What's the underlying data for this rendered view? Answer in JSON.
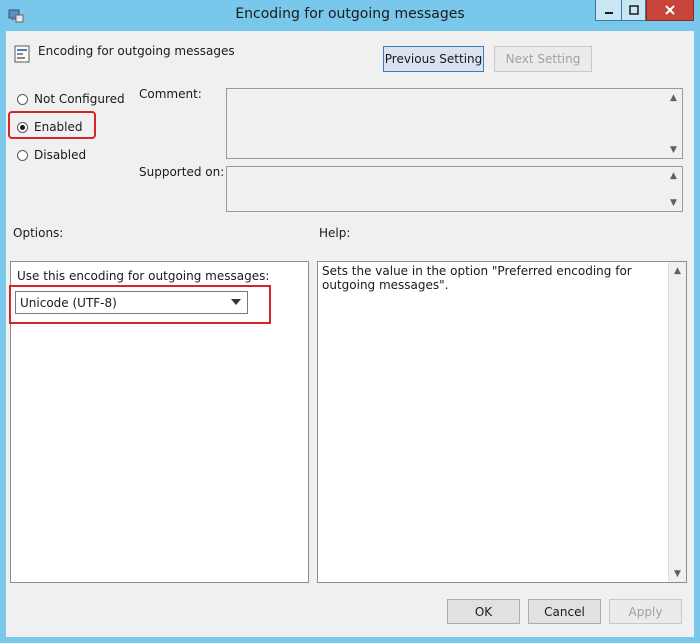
{
  "window": {
    "title": "Encoding for outgoing messages"
  },
  "header": {
    "policy_title": "Encoding for outgoing messages",
    "previous_setting": "Previous Setting",
    "next_setting": "Next Setting"
  },
  "state": {
    "options": [
      {
        "label": "Not Configured",
        "checked": false
      },
      {
        "label": "Enabled",
        "checked": true
      },
      {
        "label": "Disabled",
        "checked": false
      }
    ]
  },
  "comment": {
    "label": "Comment:",
    "value": ""
  },
  "supported": {
    "label": "Supported on:",
    "value": ""
  },
  "options_panel": {
    "heading": "Options:",
    "field_label": "Use this encoding for outgoing messages:",
    "selected": "Unicode (UTF-8)"
  },
  "help_panel": {
    "heading": "Help:",
    "text": "Sets the value in the option \"Preferred encoding for outgoing messages\"."
  },
  "footer": {
    "ok": "OK",
    "cancel": "Cancel",
    "apply": "Apply"
  },
  "colors": {
    "titlebar": "#79c7ea",
    "highlight": "#d4262c",
    "close_button": "#c7443a"
  }
}
